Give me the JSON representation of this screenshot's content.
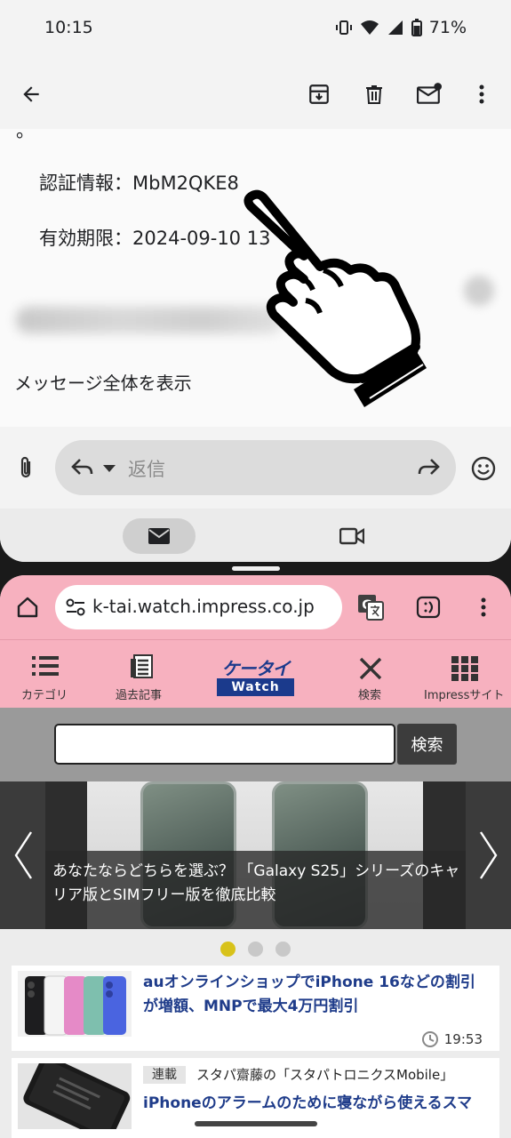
{
  "status_bar": {
    "time": "10:15",
    "battery": "71%"
  },
  "email": {
    "fragment_char": "。",
    "auth_line": "認証情報：MbM2QKE8",
    "expiry_line": "有効期限：2024-09-10 13",
    "show_full_message": "メッセージ全体を表示",
    "reply_placeholder": "返信"
  },
  "browser": {
    "url": "k-tai.watch.impress.co.jp"
  },
  "site": {
    "nav": {
      "category": "カテゴリ",
      "past_articles": "過去記事",
      "logo_top": "ケータイ",
      "logo_bottom": "Watch",
      "search": "検索",
      "impress_sites": "Impressサイト"
    },
    "search_button": "検索",
    "carousel_caption": "あなたならどちらを選ぶ？ 「Galaxy S25」シリーズのキャリア版とSIMフリー版を徹底比較",
    "carousel_dots": 3,
    "carousel_active_index": 0,
    "articles": [
      {
        "title": "auオンラインショップでiPhone 16などの割引が増額、MNPで最大4万円割引",
        "time": "19:53"
      },
      {
        "tag": "連載",
        "series": "スタパ齋藤の「スタパトロニクスMobile」",
        "title": "iPhoneのアラームのために寝ながら使えるスマ"
      }
    ]
  },
  "colors": {
    "browser_accent": "#f7b1bf",
    "link_blue": "#1f3c8a",
    "active_dot": "#d8c21a"
  }
}
